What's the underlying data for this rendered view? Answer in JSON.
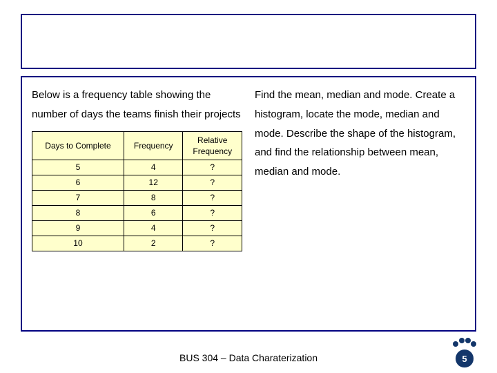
{
  "intro": "Below is a frequency table showing the number of days the teams finish their projects",
  "tasks": "Find the mean, median and mode. Create a histogram, locate the mode, median and mode. Describe the shape of the histogram, and find the relationship between mean, median and mode.",
  "table": {
    "headers": {
      "col1": "Days to Complete",
      "col2": "Frequency",
      "col3a": "Relative",
      "col3b": "Frequency"
    },
    "rows": [
      {
        "days": "5",
        "freq": "4",
        "rel": "?"
      },
      {
        "days": "6",
        "freq": "12",
        "rel": "?"
      },
      {
        "days": "7",
        "freq": "8",
        "rel": "?"
      },
      {
        "days": "8",
        "freq": "6",
        "rel": "?"
      },
      {
        "days": "9",
        "freq": "4",
        "rel": "?"
      },
      {
        "days": "10",
        "freq": "2",
        "rel": "?"
      }
    ]
  },
  "footer": "BUS 304 – Data Charaterization",
  "page_number": "5",
  "chart_data": {
    "type": "table",
    "title": "Days to Complete vs Frequency",
    "columns": [
      "Days to Complete",
      "Frequency",
      "Relative Frequency"
    ],
    "rows": [
      [
        5,
        4,
        null
      ],
      [
        6,
        12,
        null
      ],
      [
        7,
        8,
        null
      ],
      [
        8,
        6,
        null
      ],
      [
        9,
        4,
        null
      ],
      [
        10,
        2,
        null
      ]
    ]
  }
}
